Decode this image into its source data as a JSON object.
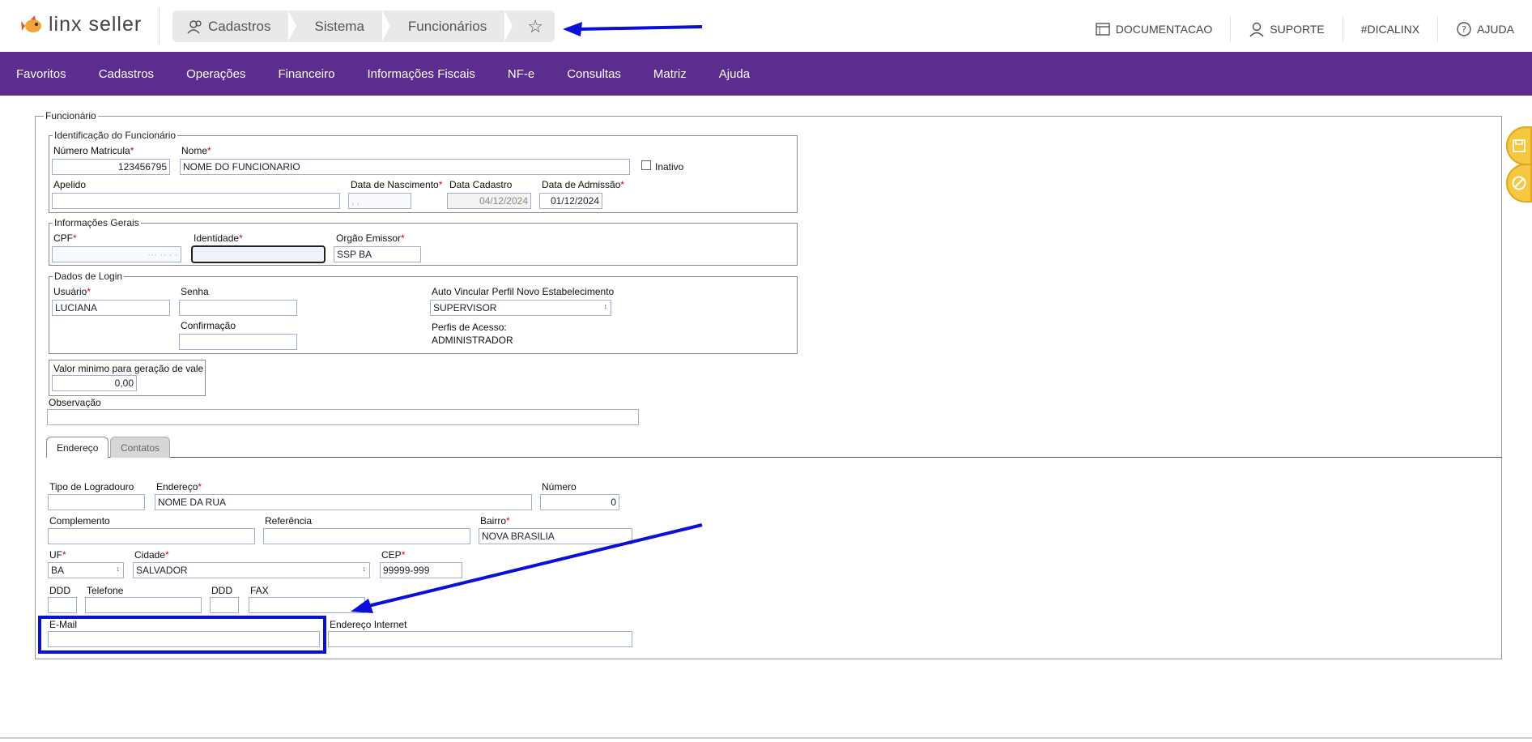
{
  "colors": {
    "nav_bg": "#5b2d8e",
    "accent_arrow": "#0a10d8",
    "required": "#dd0000",
    "side_button": "#f5c842"
  },
  "header": {
    "logo_text": "linx seller",
    "breadcrumb": [
      {
        "label": "Cadastros",
        "icon": "users-icon"
      },
      {
        "label": "Sistema"
      },
      {
        "label": "Funcionários"
      }
    ],
    "star_icon": "star-icon",
    "links": [
      {
        "label": "DOCUMENTACAO",
        "icon": "document-icon"
      },
      {
        "label": "SUPORTE",
        "icon": "user-icon"
      },
      {
        "label": "#DICALINX"
      },
      {
        "label": "AJUDA",
        "icon": "help-icon"
      }
    ]
  },
  "nav": [
    "Favoritos",
    "Cadastros",
    "Operações",
    "Financeiro",
    "Informações Fiscais",
    "NF-e",
    "Consultas",
    "Matriz",
    "Ajuda"
  ],
  "form": {
    "legend": "Funcionário",
    "identificacao": {
      "legend": "Identificação do Funcionário",
      "matricula_label": "Número Matricula",
      "matricula_value": "123456795",
      "nome_label": "Nome",
      "nome_value": "NOME DO FUNCIONARIO",
      "inativo_label": "Inativo",
      "apelido_label": "Apelido",
      "apelido_value": "",
      "nascimento_label": "Data de Nascimento",
      "nascimento_value": "  ,  ,",
      "cadastro_label": "Data Cadastro",
      "cadastro_value": "04/12/2024",
      "admissao_label": "Data de Admissão",
      "admissao_value": "01/12/2024"
    },
    "gerais": {
      "legend": "Informações Gerais",
      "cpf_label": "CPF",
      "cpf_value": "··· ·· · ·",
      "identidade_label": "Identidade",
      "identidade_value": "",
      "orgao_label": "Orgão Emissor",
      "orgao_value": "SSP BA"
    },
    "login": {
      "legend": "Dados de Login",
      "usuario_label": "Usuário",
      "usuario_value": "LUCIANA",
      "senha_label": "Senha",
      "confirmacao_label": "Confirmação",
      "auto_label": "Auto Vincular Perfil Novo Estabelecimento",
      "auto_value": "SUPERVISOR",
      "perfis_label": "Perfis de Acesso:",
      "perfis_value": "ADMINISTRADOR"
    },
    "vale_label": "Valor minimo para geração de vale",
    "vale_value": "0,00",
    "observacao_label": "Observação",
    "tabs": [
      "Endereço",
      "Contatos"
    ],
    "endereco": {
      "tipo_label": "Tipo de Logradouro",
      "endereco_label": "Endereço",
      "endereco_value": "NOME DA RUA",
      "numero_label": "Número",
      "numero_value": "0",
      "complemento_label": "Complemento",
      "referencia_label": "Referência",
      "bairro_label": "Bairro",
      "bairro_value": "NOVA BRASILIA",
      "uf_label": "UF",
      "uf_value": "BA",
      "cidade_label": "Cidade",
      "cidade_value": "SALVADOR",
      "cep_label": "CEP",
      "cep_value": "99999-999",
      "ddd_label": "DDD",
      "telefone_label": "Telefone",
      "ddd2_label": "DDD",
      "fax_label": "FAX",
      "email_label": "E-Mail",
      "internet_label": "Endereço Internet"
    }
  },
  "side_buttons": [
    "save-icon",
    "cancel-icon"
  ]
}
